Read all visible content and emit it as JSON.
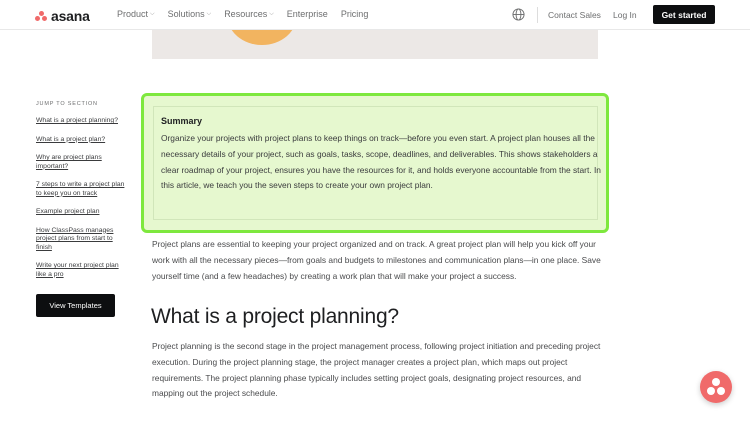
{
  "brand": {
    "name": "asana",
    "accent": "#f06a6a"
  },
  "nav": {
    "items": [
      {
        "label": "Product",
        "has_dropdown": true
      },
      {
        "label": "Solutions",
        "has_dropdown": true
      },
      {
        "label": "Resources",
        "has_dropdown": true
      },
      {
        "label": "Enterprise",
        "has_dropdown": false
      },
      {
        "label": "Pricing",
        "has_dropdown": false
      }
    ],
    "globe_icon": "globe-icon",
    "contact_sales": "Contact Sales",
    "log_in": "Log In",
    "get_started": "Get started"
  },
  "sidebar": {
    "heading": "JUMP TO SECTION",
    "items": [
      "What is a project planning?",
      "What is a project plan?",
      "Why are project plans important?",
      "7 steps to write a project plan to keep you on track",
      "Example project plan",
      "How ClassPass manages project plans from start to finish",
      "Write your next project plan like a pro"
    ],
    "button": "View Templates"
  },
  "summary": {
    "title": "Summary",
    "text": "Organize your projects with project plans to keep things on track—before you even start. A project plan houses all the necessary details of your project, such as goals, tasks, scope, deadlines, and deliverables. This shows stakeholders a clear roadmap of your project, ensures you have the resources for it, and holds everyone accountable from the start. In this article, we teach you the seven steps to create your own project plan.",
    "highlight_color": "#7ee83e"
  },
  "article": {
    "intro": "Project plans are essential to keeping your project organized and on track. A great project plan will help you kick off your work with all the necessary pieces—from goals and budgets to milestones and communication plans—in one place. Save yourself time (and a few headaches) by creating a work plan that will make your project a success.",
    "heading": "What is a project planning?",
    "body": "Project planning is the second stage in the project management process, following project initiation and preceding project execution. During the project planning stage, the project manager creates a project plan, which maps out project requirements. The project planning phase typically includes setting project goals, designating project resources, and mapping out the project schedule."
  },
  "help_widget": {
    "icon": "asana-dots-icon"
  }
}
